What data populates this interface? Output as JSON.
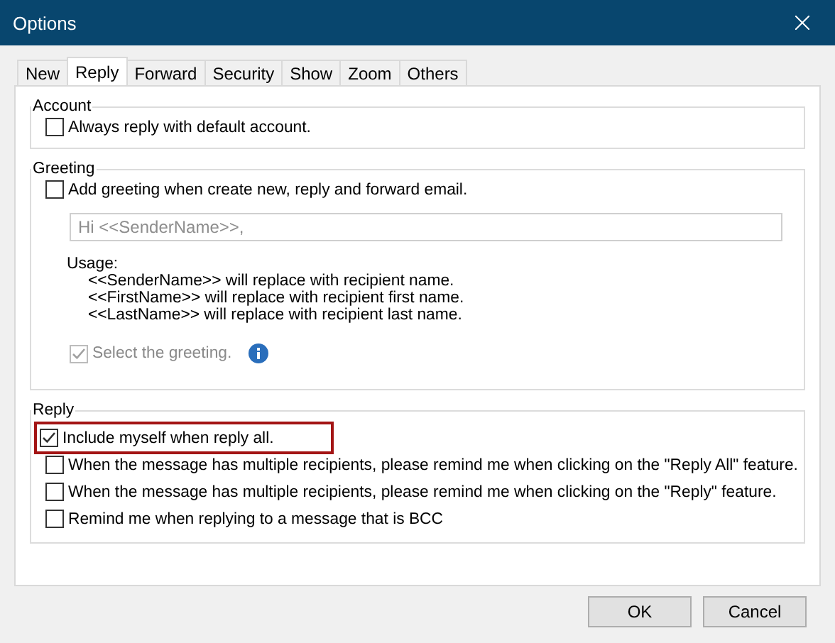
{
  "window": {
    "title": "Options"
  },
  "tabs": [
    {
      "label": "New",
      "selected": false
    },
    {
      "label": "Reply",
      "selected": true
    },
    {
      "label": "Forward",
      "selected": false
    },
    {
      "label": "Security",
      "selected": false
    },
    {
      "label": "Show",
      "selected": false
    },
    {
      "label": "Zoom",
      "selected": false
    },
    {
      "label": "Others",
      "selected": false
    }
  ],
  "account": {
    "title": "Account",
    "options": [
      {
        "label": "Always reply with default account.",
        "checked": false,
        "disabled": false,
        "highlighted": false
      }
    ]
  },
  "greeting": {
    "title": "Greeting",
    "option": {
      "label": "Add greeting when create new, reply and forward email.",
      "checked": false,
      "disabled": false,
      "highlighted": false
    },
    "field": {
      "placeholder": "Hi <<SenderName>>,"
    },
    "usage_title": "Usage:",
    "usage_lines": [
      "<<SenderName>> will replace with recipient name.",
      "<<FirstName>> will replace with recipient first name.",
      "<<LastName>> will replace with recipient last name."
    ],
    "select": {
      "label": "Select the greeting.",
      "checked": true,
      "disabled": true,
      "highlighted": false
    }
  },
  "reply": {
    "title": "Reply",
    "options": [
      {
        "label": "Include myself when reply all.",
        "checked": true,
        "disabled": false,
        "highlighted": true
      },
      {
        "label": "When the message has multiple recipients, please remind me when clicking on the \"Reply All\" feature.",
        "checked": false,
        "disabled": false,
        "highlighted": false
      },
      {
        "label": "When the message has multiple recipients, please remind me when clicking on the \"Reply\" feature.",
        "checked": false,
        "disabled": false,
        "highlighted": false
      },
      {
        "label": "Remind me when replying to a message that is BCC",
        "checked": false,
        "disabled": false,
        "highlighted": false
      }
    ]
  },
  "buttons": [
    "OK",
    "Cancel"
  ]
}
